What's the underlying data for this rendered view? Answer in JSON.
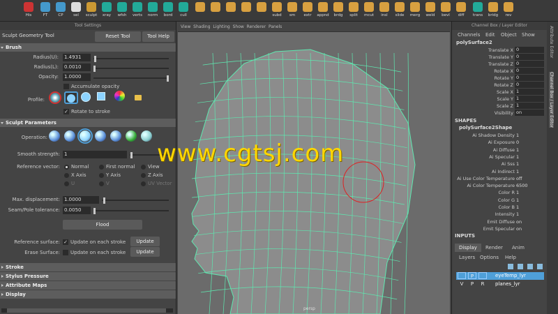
{
  "shelf": {
    "items": [
      {
        "label": "His",
        "color": "#c33"
      },
      {
        "label": "FT",
        "color": "#49c"
      },
      {
        "label": "CP",
        "color": "#49c"
      },
      {
        "label": "sel",
        "color": "#ddd"
      },
      {
        "label": "sculpt",
        "color": "#c93"
      },
      {
        "label": "xray",
        "color": "#2a9"
      },
      {
        "label": "wfsh",
        "color": "#2a9"
      },
      {
        "label": "verts",
        "color": "#2a9"
      },
      {
        "label": "norm",
        "color": "#2a9"
      },
      {
        "label": "bord",
        "color": "#2a9"
      },
      {
        "label": "cull",
        "color": "#2a9"
      },
      {
        "label": "",
        "color": "#d8a040"
      },
      {
        "label": "",
        "color": "#d8a040"
      },
      {
        "label": "",
        "color": "#d8a040"
      },
      {
        "label": "",
        "color": "#d8a040"
      },
      {
        "label": "",
        "color": "#d8a040"
      },
      {
        "label": "subd",
        "color": "#d8a040"
      },
      {
        "label": "sm",
        "color": "#d8a040"
      },
      {
        "label": "extr",
        "color": "#d8a040"
      },
      {
        "label": "appnd",
        "color": "#d8a040"
      },
      {
        "label": "brdg",
        "color": "#d8a040"
      },
      {
        "label": "split",
        "color": "#d8a040"
      },
      {
        "label": "mcut",
        "color": "#d8a040"
      },
      {
        "label": "insl",
        "color": "#d8a040"
      },
      {
        "label": "slide",
        "color": "#d8a040"
      },
      {
        "label": "merg",
        "color": "#d8a040"
      },
      {
        "label": "weld",
        "color": "#d8a040"
      },
      {
        "label": "bevl",
        "color": "#d8a040"
      },
      {
        "label": "diff",
        "color": "#d8a040"
      },
      {
        "label": "trans",
        "color": "#2a9"
      },
      {
        "label": "bridg",
        "color": "#d8a040"
      },
      {
        "label": "rev",
        "color": "#d8a040"
      }
    ]
  },
  "tool": {
    "panel_title": "Tool Settings",
    "name": "Sculpt Geometry Tool",
    "reset": "Reset Tool",
    "help": "Tool Help"
  },
  "brush": {
    "title": "Brush",
    "radius_u_label": "Radius(U):",
    "radius_u": "1.4931",
    "radius_l_label": "Radius(L):",
    "radius_l": "0.0010",
    "opacity_label": "Opacity:",
    "opacity": "1.0000",
    "accumulate": "Accumulate opacity",
    "profile_label": "Profile:",
    "rotate": "Rotate to stroke"
  },
  "sculpt": {
    "title": "Sculpt Parameters",
    "operation_label": "Operation:",
    "smooth_label": "Smooth strength:",
    "smooth": "1",
    "refvec_label": "Reference vector:",
    "refvec_options": [
      {
        "label": "Normal",
        "on": true,
        "dim": false
      },
      {
        "label": "First normal",
        "on": false,
        "dim": false
      },
      {
        "label": "View",
        "on": false,
        "dim": false
      },
      {
        "label": "X Axis",
        "on": false,
        "dim": false
      },
      {
        "label": "Y Axis",
        "on": false,
        "dim": false
      },
      {
        "label": "Z Axis",
        "on": false,
        "dim": false
      },
      {
        "label": "U",
        "on": false,
        "dim": true
      },
      {
        "label": "V",
        "on": false,
        "dim": true
      },
      {
        "label": "UV Vector",
        "on": false,
        "dim": true
      }
    ],
    "maxdisp_label": "Max. displacement:",
    "maxdisp": "1.0000",
    "seam_label": "Seam/Pole tolerance:",
    "seam": "0.0050",
    "flood": "Flood",
    "refsurf_label": "Reference surface:",
    "refsurf_text": "Update on each stroke",
    "erase_label": "Erase Surface:",
    "erase_text": "Update on each stroke",
    "update": "Update"
  },
  "collapsed": [
    "Stroke",
    "Stylus Pressure",
    "Attribute Maps",
    "Display"
  ],
  "viewport": {
    "menu": "View Shading Lighting Show Renderer Panels",
    "camera": "persp"
  },
  "channelbox": {
    "title": "Channel Box / Layer Editor",
    "menus": [
      "Channels",
      "Edit",
      "Object",
      "Show"
    ],
    "object": "polySurface2",
    "channels": [
      {
        "label": "Translate X",
        "value": "0"
      },
      {
        "label": "Translate Y",
        "value": "0"
      },
      {
        "label": "Translate Z",
        "value": "0"
      },
      {
        "label": "Rotate X",
        "value": "0"
      },
      {
        "label": "Rotate Y",
        "value": "0"
      },
      {
        "label": "Rotate Z",
        "value": "0"
      },
      {
        "label": "Scale X",
        "value": "1"
      },
      {
        "label": "Scale Y",
        "value": "1"
      },
      {
        "label": "Scale Z",
        "value": "1"
      },
      {
        "label": "Visibility",
        "value": "on"
      }
    ],
    "shapes_title": "SHAPES",
    "shape_name": "polySurface2Shape",
    "shape_attrs": [
      {
        "label": "Ai Shadow Density",
        "value": "1"
      },
      {
        "label": "Ai Exposure",
        "value": "0"
      },
      {
        "label": "Ai Diffuse",
        "value": "1"
      },
      {
        "label": "Ai Specular",
        "value": "1"
      },
      {
        "label": "Ai Sss",
        "value": "1"
      },
      {
        "label": "Ai Indirect",
        "value": "1"
      },
      {
        "label": "Ai Use Color Temperature",
        "value": "off"
      },
      {
        "label": "Ai Color Temperature",
        "value": "6500"
      },
      {
        "label": "Color R",
        "value": "1"
      },
      {
        "label": "Color G",
        "value": "1"
      },
      {
        "label": "Color B",
        "value": "1"
      },
      {
        "label": "Intensity",
        "value": "1"
      },
      {
        "label": "Emit Diffuse",
        "value": "on"
      },
      {
        "label": "Emit Specular",
        "value": "on"
      }
    ],
    "inputs_title": "INPUTS",
    "tabs": [
      "Display",
      "Render",
      "Anim"
    ],
    "layer_menus": [
      "Layers",
      "Options",
      "Help"
    ],
    "layers": [
      {
        "v": "",
        "p": "P",
        "r": "",
        "name": "eyeTemp_lyr",
        "selected": true
      },
      {
        "v": "V",
        "p": "P",
        "r": "R",
        "name": "planes_lyr",
        "selected": false
      }
    ]
  },
  "side_tabs": [
    "Attribute Editor",
    "Channel Box / Layer Editor"
  ],
  "watermark": "www.cgtsj.com",
  "colors": {
    "wire": "#5ee8b0",
    "accent": "#4f9fd8",
    "brush": "#d22"
  }
}
